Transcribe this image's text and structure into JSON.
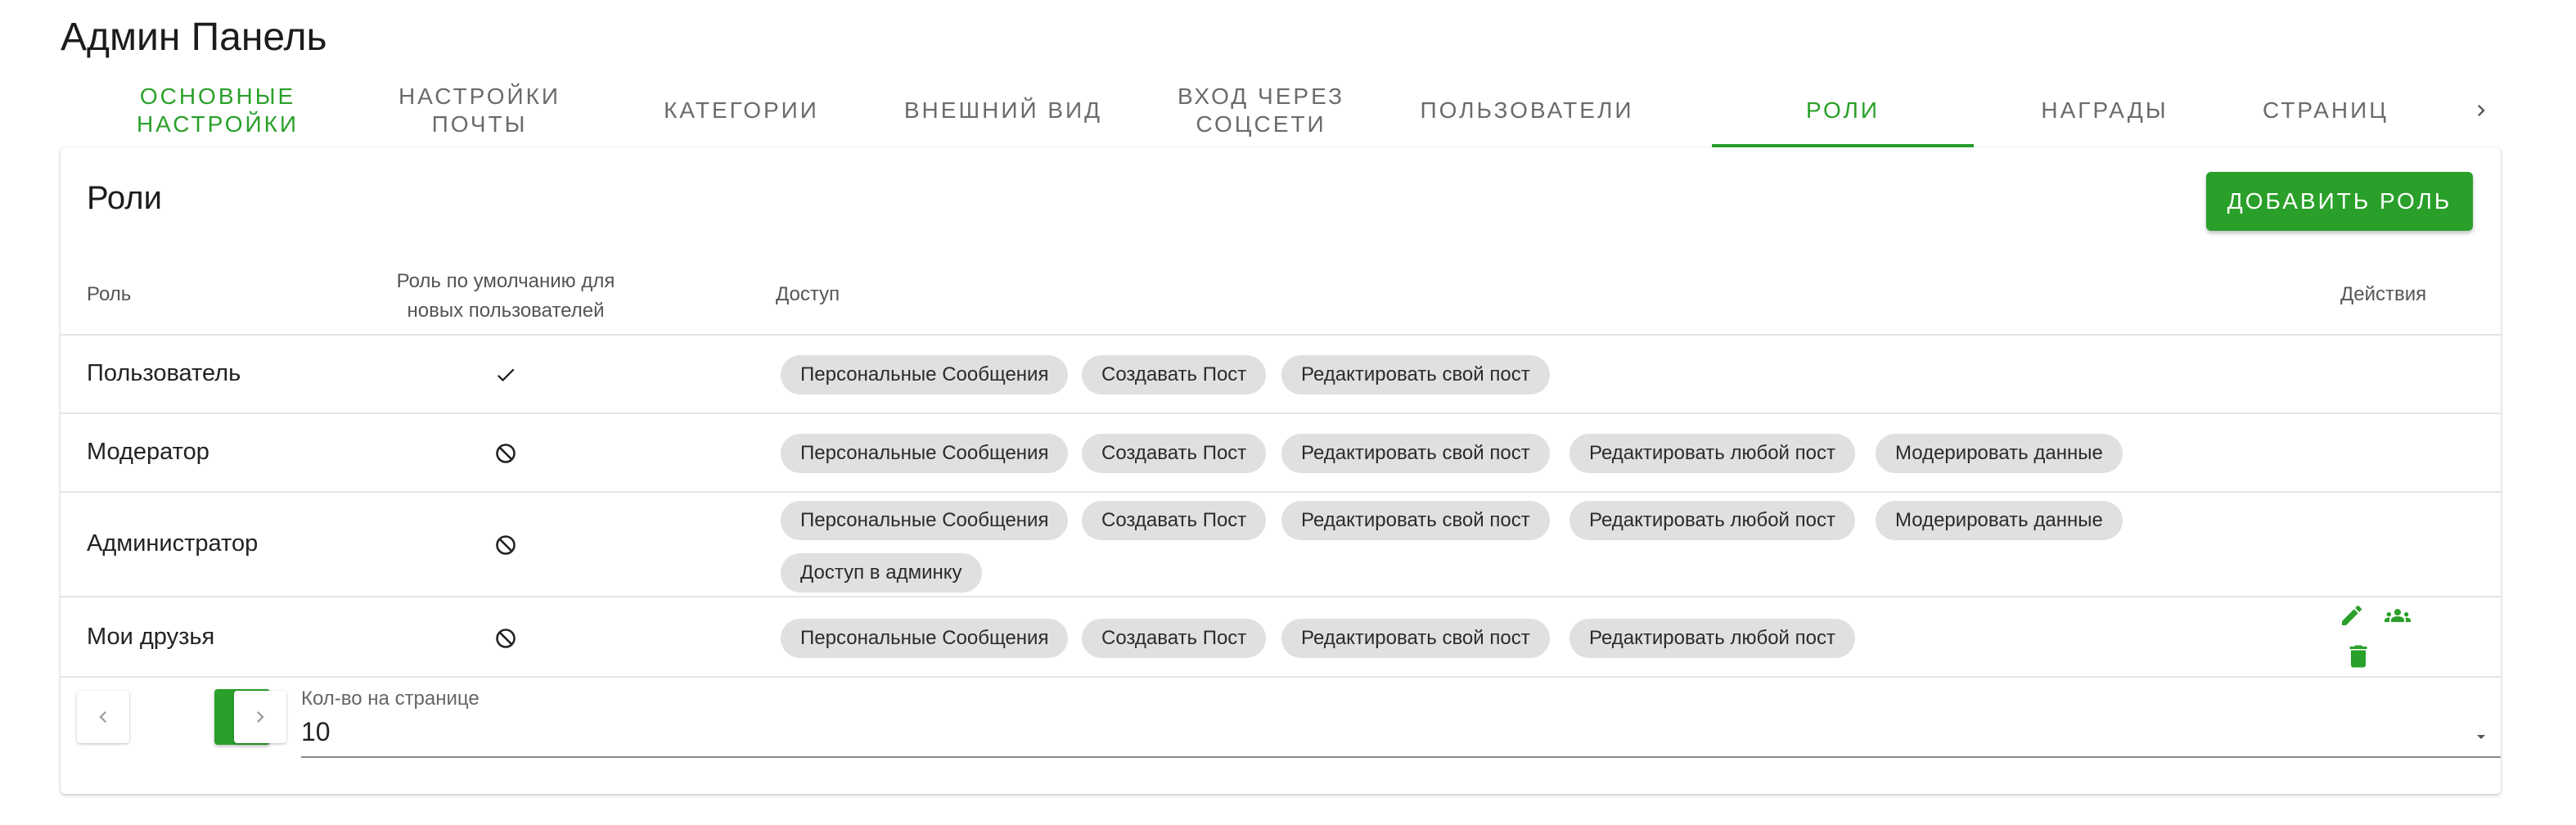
{
  "header": {
    "title": "Админ Панель"
  },
  "tabs": [
    {
      "label": "Основные настройки"
    },
    {
      "label": "Настройки почты"
    },
    {
      "label": "Категории"
    },
    {
      "label": "Внешний вид"
    },
    {
      "label": "Вход через соцсети"
    },
    {
      "label": "Пользователи"
    },
    {
      "label": "Роли",
      "active": true
    },
    {
      "label": "Награды"
    },
    {
      "label": "Страниц"
    }
  ],
  "card": {
    "title": "Роли",
    "add_button": "Добавить роль"
  },
  "table": {
    "headers": {
      "role": "Роль",
      "default": "Роль по умолчанию для новых пользователей",
      "access": "Доступ",
      "actions": "Действия"
    },
    "rows": [
      {
        "name": "Пользователь",
        "default": "check-icon",
        "access": [
          "Персональные Сообщения",
          "Создавать Пост",
          "Редактировать свой пост"
        ]
      },
      {
        "name": "Модератор",
        "default": "block-icon",
        "access": [
          "Персональные Сообщения",
          "Создавать Пост",
          "Редактировать свой пост",
          "Редактировать любой пост",
          "Модерировать данные"
        ]
      },
      {
        "name": "Администратор",
        "default": "block-icon",
        "access": [
          "Персональные Сообщения",
          "Создавать Пост",
          "Редактировать свой пост",
          "Редактировать любой пост",
          "Модерировать данные",
          "Доступ в админку"
        ]
      },
      {
        "name": "Мои друзья",
        "default": "block-icon",
        "access": [
          "Персональные Сообщения",
          "Создавать Пост",
          "Редактировать свой пост",
          "Редактировать любой пост"
        ],
        "actions": [
          "edit-icon",
          "group-icon",
          "delete-icon"
        ]
      }
    ]
  },
  "pagination": {
    "current_page": "1",
    "per_page_label": "Кол-во на странице",
    "per_page_value": "10"
  },
  "colors": {
    "accent": "#2aa02a",
    "chip_bg": "#e0e0e0"
  }
}
